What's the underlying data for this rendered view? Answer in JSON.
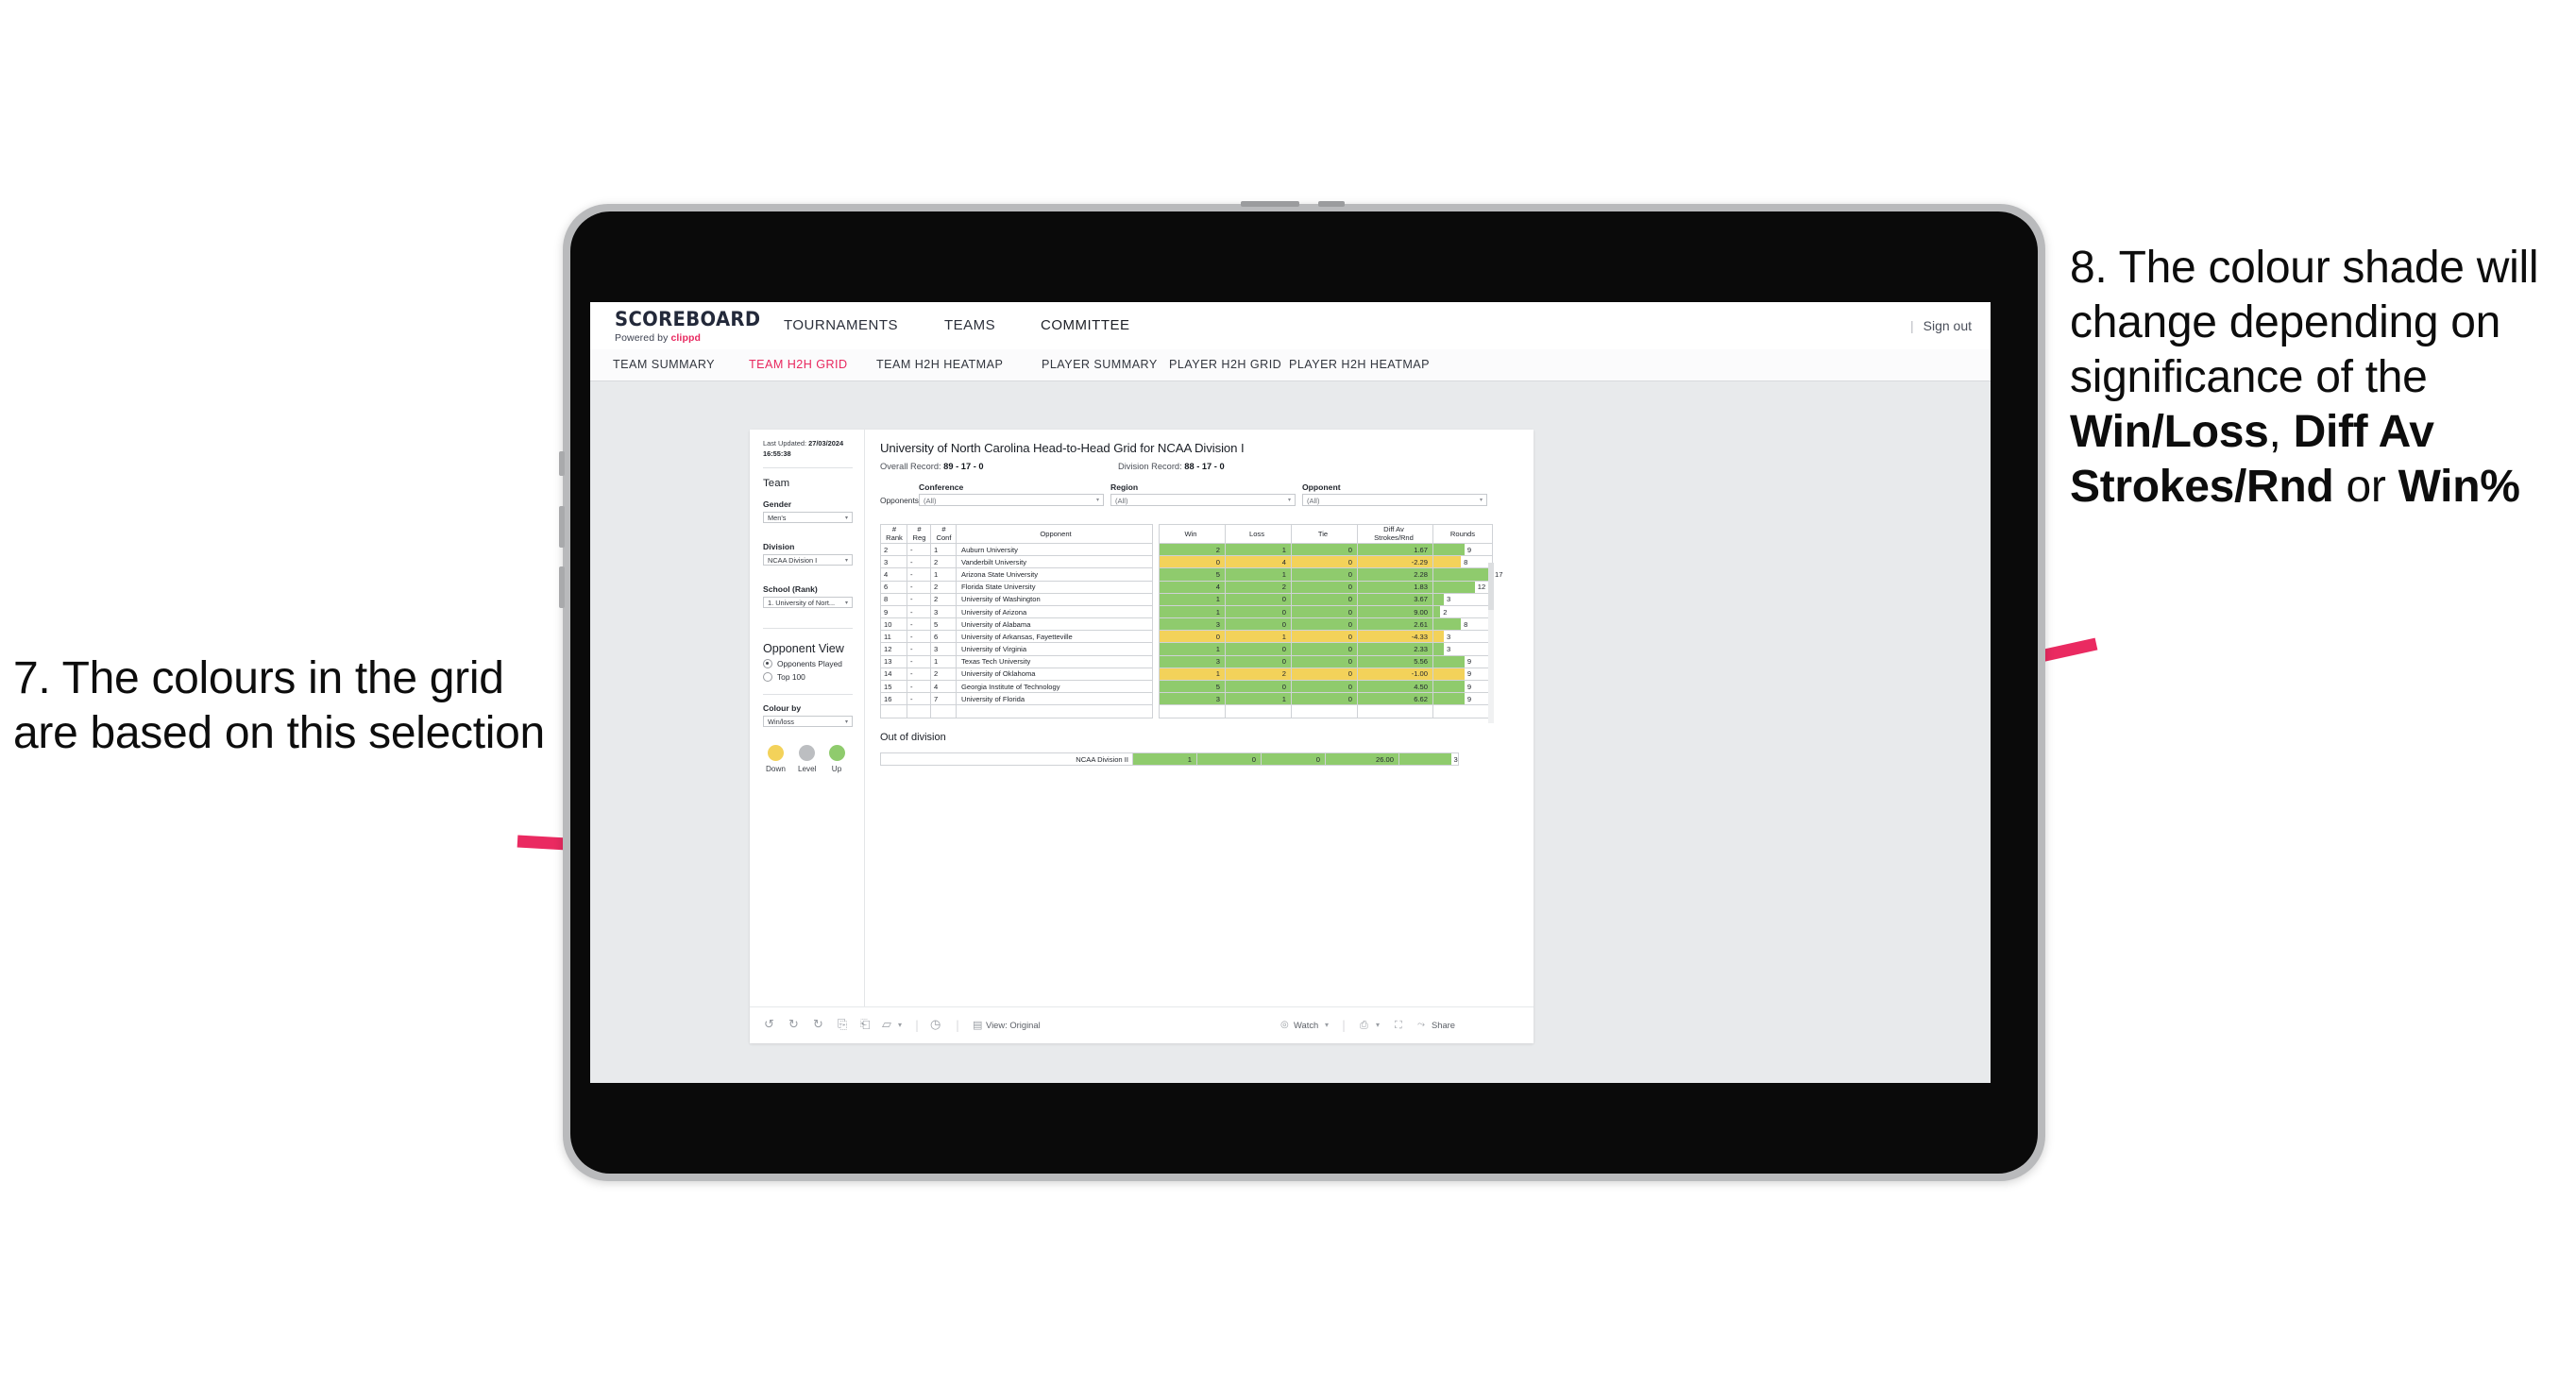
{
  "annotations": {
    "left": "7. The colours in the grid are based on this selection",
    "right_prefix": "8. The colour shade will change depending on significance of the ",
    "right_b1": "Win/Loss",
    "right_mid1": ", ",
    "right_b2": "Diff Av Strokes/Rnd",
    "right_mid2": " or ",
    "right_b3": "Win%"
  },
  "colors": {
    "accent_pink": "#e8285f",
    "arrow_pink": "#ea2a61",
    "up_green": "#8fcb6d",
    "down_yellow": "#f3d25a",
    "level_grey": "#bcbec1"
  },
  "topnav": {
    "logo_title": "SCOREBOARD",
    "logo_sub_prefix": "Powered by ",
    "logo_sub_brand": "clippd",
    "items": [
      {
        "label": "TOURNAMENTS",
        "active": false
      },
      {
        "label": "TEAMS",
        "active": false
      },
      {
        "label": "COMMITTEE",
        "active": true
      }
    ],
    "divider": "|",
    "signout": "Sign out"
  },
  "subnav": {
    "items": [
      {
        "label": "TEAM SUMMARY",
        "active": false
      },
      {
        "label": "TEAM H2H GRID",
        "active": true
      },
      {
        "label": "TEAM H2H HEATMAP",
        "active": false
      },
      {
        "label": "PLAYER SUMMARY",
        "active": false
      },
      {
        "label": "PLAYER H2H GRID",
        "active": false
      },
      {
        "label": "PLAYER H2H HEATMAP",
        "active": false
      }
    ]
  },
  "panel": {
    "last_updated_label": "Last Updated:",
    "last_updated_value": "27/03/2024 16:55:38",
    "team_heading": "Team",
    "gender_label": "Gender",
    "gender_value": "Men's",
    "division_label": "Division",
    "division_value": "NCAA Division I",
    "school_label": "School (Rank)",
    "school_value": "1. University of Nort...",
    "opponent_view_heading": "Opponent View",
    "radio_opponents_played": "Opponents Played",
    "radio_top_100": "Top 100",
    "colour_by_label": "Colour by",
    "colour_by_value": "Win/loss",
    "legend": [
      {
        "label": "Down",
        "color": "#f3d25a"
      },
      {
        "label": "Level",
        "color": "#bcbec1"
      },
      {
        "label": "Up",
        "color": "#8fcb6d"
      }
    ]
  },
  "main": {
    "title": "University of North Carolina Head-to-Head Grid for NCAA Division I",
    "overall_record_label": "Overall Record: ",
    "overall_record_value": "89 - 17 - 0",
    "division_record_label": "Division Record: ",
    "division_record_value": "88 - 17 - 0",
    "opponents_label": "Opponents:",
    "filters": [
      {
        "label": "Conference",
        "value": "(All)"
      },
      {
        "label": "Region",
        "value": "(All)"
      },
      {
        "label": "Opponent",
        "value": "(All)"
      }
    ],
    "columns": [
      "# Rank",
      "# Reg",
      "# Conf",
      "Opponent",
      "Win",
      "Loss",
      "Tie",
      "Diff Av Strokes/Rnd",
      "Rounds"
    ],
    "column_lines": [
      [
        "#",
        "Rank"
      ],
      [
        "#",
        "Reg"
      ],
      [
        "#",
        "Conf"
      ],
      [
        "",
        "Opponent"
      ],
      [
        "",
        "Win"
      ],
      [
        "",
        "Loss"
      ],
      [
        "",
        "Tie"
      ],
      [
        "Diff Av",
        "Strokes/Rnd"
      ],
      [
        "",
        "Rounds"
      ]
    ],
    "out_of_division_heading": "Out of division",
    "out_of_division_row": {
      "label": "NCAA Division II",
      "win": "1",
      "loss": "0",
      "tie": "0",
      "diff": "26.00",
      "rounds": "3",
      "state": "up"
    }
  },
  "chart_data": {
    "type": "table",
    "title": "University of North Carolina Head-to-Head Grid for NCAA Division I",
    "columns": [
      "# Rank",
      "# Reg",
      "# Conf",
      "Opponent",
      "Win",
      "Loss",
      "Tie",
      "Diff Av Strokes/Rnd",
      "Rounds"
    ],
    "rounds_max": 17,
    "rows": [
      {
        "rank": "2",
        "reg": "-",
        "conf": "1",
        "opponent": "Auburn University",
        "win": "2",
        "loss": "1",
        "tie": "0",
        "diff": "1.67",
        "rounds": "9",
        "state": "up"
      },
      {
        "rank": "3",
        "reg": "-",
        "conf": "2",
        "opponent": "Vanderbilt University",
        "win": "0",
        "loss": "4",
        "tie": "0",
        "diff": "-2.29",
        "rounds": "8",
        "state": "down"
      },
      {
        "rank": "4",
        "reg": "-",
        "conf": "1",
        "opponent": "Arizona State University",
        "win": "5",
        "loss": "1",
        "tie": "0",
        "diff": "2.28",
        "rounds": "17",
        "state": "up"
      },
      {
        "rank": "6",
        "reg": "-",
        "conf": "2",
        "opponent": "Florida State University",
        "win": "4",
        "loss": "2",
        "tie": "0",
        "diff": "1.83",
        "rounds": "12",
        "state": "up"
      },
      {
        "rank": "8",
        "reg": "-",
        "conf": "2",
        "opponent": "University of Washington",
        "win": "1",
        "loss": "0",
        "tie": "0",
        "diff": "3.67",
        "rounds": "3",
        "state": "up"
      },
      {
        "rank": "9",
        "reg": "-",
        "conf": "3",
        "opponent": "University of Arizona",
        "win": "1",
        "loss": "0",
        "tie": "0",
        "diff": "9.00",
        "rounds": "2",
        "state": "up"
      },
      {
        "rank": "10",
        "reg": "-",
        "conf": "5",
        "opponent": "University of Alabama",
        "win": "3",
        "loss": "0",
        "tie": "0",
        "diff": "2.61",
        "rounds": "8",
        "state": "up"
      },
      {
        "rank": "11",
        "reg": "-",
        "conf": "6",
        "opponent": "University of Arkansas, Fayetteville",
        "win": "0",
        "loss": "1",
        "tie": "0",
        "diff": "-4.33",
        "rounds": "3",
        "state": "down"
      },
      {
        "rank": "12",
        "reg": "-",
        "conf": "3",
        "opponent": "University of Virginia",
        "win": "1",
        "loss": "0",
        "tie": "0",
        "diff": "2.33",
        "rounds": "3",
        "state": "up"
      },
      {
        "rank": "13",
        "reg": "-",
        "conf": "1",
        "opponent": "Texas Tech University",
        "win": "3",
        "loss": "0",
        "tie": "0",
        "diff": "5.56",
        "rounds": "9",
        "state": "up"
      },
      {
        "rank": "14",
        "reg": "-",
        "conf": "2",
        "opponent": "University of Oklahoma",
        "win": "1",
        "loss": "2",
        "tie": "0",
        "diff": "-1.00",
        "rounds": "9",
        "state": "down"
      },
      {
        "rank": "15",
        "reg": "-",
        "conf": "4",
        "opponent": "Georgia Institute of Technology",
        "win": "5",
        "loss": "0",
        "tie": "0",
        "diff": "4.50",
        "rounds": "9",
        "state": "up"
      },
      {
        "rank": "16",
        "reg": "-",
        "conf": "7",
        "opponent": "University of Florida",
        "win": "3",
        "loss": "1",
        "tie": "0",
        "diff": "6.62",
        "rounds": "9",
        "state": "up"
      }
    ]
  },
  "toolbar": {
    "undo": "↺",
    "redo": "↻",
    "revert": "↻",
    "refresh": "⟳",
    "pause": "⏸",
    "view_label": "View: Original",
    "watch": "Watch",
    "share": "Share",
    "caret": "▾",
    "sep": "|"
  }
}
